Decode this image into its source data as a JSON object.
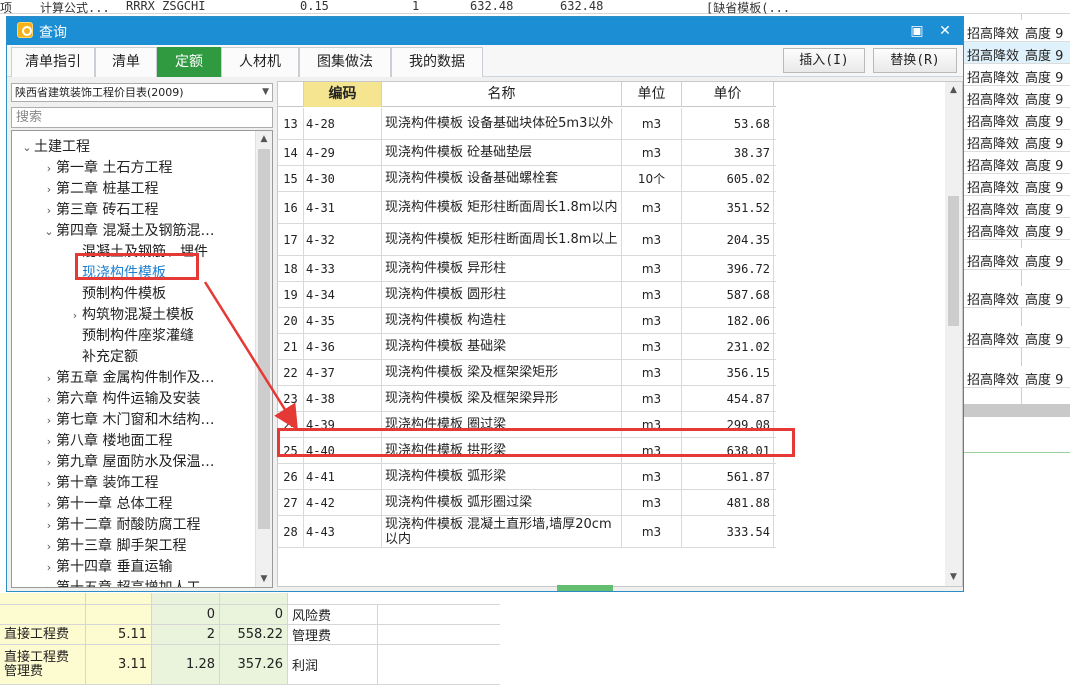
{
  "background": {
    "top_row": [
      "项",
      "计算公式...",
      "RRRX ZSGCHI",
      "0.15",
      "1",
      "632.48",
      "632.48",
      "[缺省模板(..."
    ],
    "right_rows": [
      {
        "c1": "招高降效",
        "c2": "高度 9",
        "selected": false
      },
      {
        "c1": "招高降效",
        "c2": "高度 9",
        "selected": true
      },
      {
        "c1": "招高降效",
        "c2": "高度 9",
        "selected": false
      },
      {
        "c1": "招高降效",
        "c2": "高度 9",
        "selected": false
      },
      {
        "c1": "招高降效",
        "c2": "高度 9",
        "selected": false
      },
      {
        "c1": "招高降效",
        "c2": "高度 9",
        "selected": false
      },
      {
        "c1": "招高降效",
        "c2": "高度 9",
        "selected": false
      },
      {
        "c1": "招高降效",
        "c2": "高度 9",
        "selected": false
      },
      {
        "c1": "招高降效",
        "c2": "高度 9",
        "selected": false
      },
      {
        "c1": "招高降效",
        "c2": "高度 9",
        "selected": false
      },
      {
        "c1": "招高降效",
        "c2": "高度 9",
        "selected": false
      },
      {
        "c1": "招高降效",
        "c2": "高度 9",
        "selected": false
      },
      {
        "c1": "招高降效",
        "c2": "高度 9",
        "selected": false
      },
      {
        "c1": "招高降效",
        "c2": "高度 9",
        "selected": false
      }
    ],
    "bottom_rows": [
      {
        "label": "",
        "a": "",
        "b": "0",
        "c": "0",
        "name": "风险费"
      },
      {
        "label": "直接工程费",
        "a": "5.11",
        "b": "2",
        "c": "558.22",
        "name": "管理费"
      },
      {
        "label": "直接工程费 管理费",
        "a": "3.11",
        "b": "1.28",
        "c": "357.26",
        "name": "利润"
      }
    ]
  },
  "dialog": {
    "title": "查询",
    "tabs": [
      "清单指引",
      "清单",
      "定额",
      "人材机",
      "图集做法",
      "我的数据"
    ],
    "active_tab": 2,
    "insert_label": "插入(I)",
    "replace_label": "替换(R)",
    "library": "陕西省建筑装饰工程价目表(2009)",
    "search_placeholder": "搜索",
    "tree": [
      {
        "label": "土建工程",
        "level": 0,
        "toggle": "⌄"
      },
      {
        "label": "第一章  土石方工程",
        "level": 1,
        "toggle": "›"
      },
      {
        "label": "第二章  桩基工程",
        "level": 1,
        "toggle": "›"
      },
      {
        "label": "第三章  砖石工程",
        "level": 1,
        "toggle": "›"
      },
      {
        "label": "第四章  混凝土及钢筋混…",
        "level": 1,
        "toggle": "⌄"
      },
      {
        "label": "混凝土及钢筋、埋件",
        "level": 2,
        "toggle": ""
      },
      {
        "label": "现浇构件模板",
        "level": 2,
        "toggle": "",
        "highlight": true
      },
      {
        "label": "预制构件模板",
        "level": 2,
        "toggle": ""
      },
      {
        "label": "构筑物混凝土模板",
        "level": 2,
        "toggle": "›"
      },
      {
        "label": "预制构件座浆灌缝",
        "level": 2,
        "toggle": ""
      },
      {
        "label": "补充定额",
        "level": 2,
        "toggle": ""
      },
      {
        "label": "第五章  金属构件制作及…",
        "level": 1,
        "toggle": "›"
      },
      {
        "label": "第六章  构件运输及安装",
        "level": 1,
        "toggle": "›"
      },
      {
        "label": "第七章  木门窗和木结构…",
        "level": 1,
        "toggle": "›"
      },
      {
        "label": "第八章  楼地面工程",
        "level": 1,
        "toggle": "›"
      },
      {
        "label": "第九章  屋面防水及保温…",
        "level": 1,
        "toggle": "›"
      },
      {
        "label": "第十章  装饰工程",
        "level": 1,
        "toggle": "›"
      },
      {
        "label": "第十一章  总体工程",
        "level": 1,
        "toggle": "›"
      },
      {
        "label": "第十二章  耐酸防腐工程",
        "level": 1,
        "toggle": "›"
      },
      {
        "label": "第十三章  脚手架工程",
        "level": 1,
        "toggle": "›"
      },
      {
        "label": "第十四章  垂直运输",
        "level": 1,
        "toggle": "›"
      },
      {
        "label": "第十五章  超高增加人工…",
        "level": 1,
        "toggle": "›"
      }
    ],
    "table": {
      "headers": {
        "no": "",
        "code": "编码",
        "name": "名称",
        "unit": "单位",
        "price": "单价"
      },
      "rows": [
        {
          "no": "13",
          "code": "4-28",
          "name": "现浇构件模板 设备基础块体砼5m3以外",
          "unit": "m3",
          "price": "53.68"
        },
        {
          "no": "14",
          "code": "4-29",
          "name": "现浇构件模板 砼基础垫层",
          "unit": "m3",
          "price": "38.37"
        },
        {
          "no": "15",
          "code": "4-30",
          "name": "现浇构件模板 设备基础螺栓套",
          "unit": "10个",
          "price": "605.02"
        },
        {
          "no": "16",
          "code": "4-31",
          "name": "现浇构件模板 矩形柱断面周长1.8m以内",
          "unit": "m3",
          "price": "351.52"
        },
        {
          "no": "17",
          "code": "4-32",
          "name": "现浇构件模板 矩形柱断面周长1.8m以上",
          "unit": "m3",
          "price": "204.35"
        },
        {
          "no": "18",
          "code": "4-33",
          "name": "现浇构件模板 异形柱",
          "unit": "m3",
          "price": "396.72"
        },
        {
          "no": "19",
          "code": "4-34",
          "name": "现浇构件模板 圆形柱",
          "unit": "m3",
          "price": "587.68"
        },
        {
          "no": "20",
          "code": "4-35",
          "name": "现浇构件模板 构造柱",
          "unit": "m3",
          "price": "182.06"
        },
        {
          "no": "21",
          "code": "4-36",
          "name": "现浇构件模板 基础梁",
          "unit": "m3",
          "price": "231.02"
        },
        {
          "no": "22",
          "code": "4-37",
          "name": "现浇构件模板 梁及框架梁矩形",
          "unit": "m3",
          "price": "356.15"
        },
        {
          "no": "23",
          "code": "4-38",
          "name": "现浇构件模板 梁及框架梁异形",
          "unit": "m3",
          "price": "454.87"
        },
        {
          "no": "24",
          "code": "4-39",
          "name": "现浇构件模板 圈过梁",
          "unit": "m3",
          "price": "299.08"
        },
        {
          "no": "25",
          "code": "4-40",
          "name": "现浇构件模板 拱形梁",
          "unit": "m3",
          "price": "638.01"
        },
        {
          "no": "26",
          "code": "4-41",
          "name": "现浇构件模板 弧形梁",
          "unit": "m3",
          "price": "561.87"
        },
        {
          "no": "27",
          "code": "4-42",
          "name": "现浇构件模板 弧形圈过梁",
          "unit": "m3",
          "price": "481.88"
        },
        {
          "no": "28",
          "code": "4-43",
          "name": "现浇构件模板 混凝土直形墙,墙厚20cm以内",
          "unit": "m3",
          "price": "333.54"
        }
      ]
    }
  },
  "colors": {
    "titlebar": "#1c8ed4",
    "active_tab": "#2f9a40",
    "annotation": "#e53935",
    "highlight_text": "#1d7fd0"
  }
}
